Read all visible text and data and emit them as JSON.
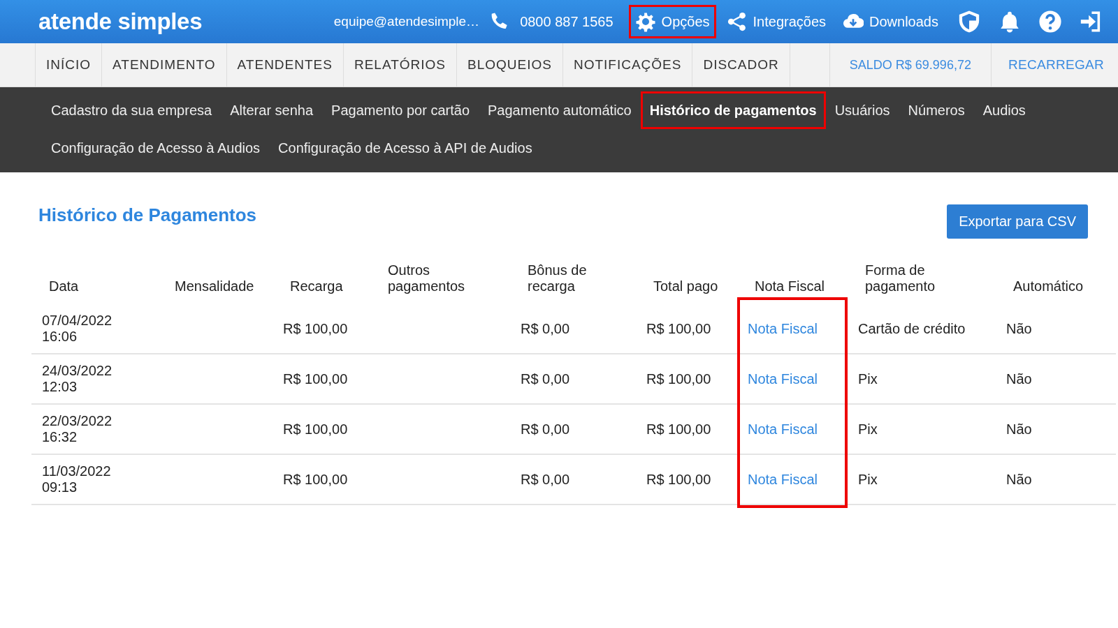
{
  "topbar": {
    "logo": "atende simples",
    "email": "equipe@atendesimple…",
    "phone": "0800 887 1565",
    "actions": [
      {
        "kind": "gear",
        "label": "Opções",
        "highlighted": true
      },
      {
        "kind": "share",
        "label": "Integrações",
        "highlighted": false
      },
      {
        "kind": "download",
        "label": "Downloads",
        "highlighted": false
      }
    ],
    "icons": [
      {
        "kind": "shield"
      },
      {
        "kind": "bell"
      },
      {
        "kind": "help"
      },
      {
        "kind": "signin"
      }
    ]
  },
  "nav": {
    "items": [
      "INÍCIO",
      "ATENDIMENTO",
      "ATENDENTES",
      "RELATÓRIOS",
      "BLOQUEIOS",
      "NOTIFICAÇÕES",
      "DISCADOR"
    ],
    "balance": "SALDO R$ 69.996,72",
    "recharge": "RECARREGAR"
  },
  "submenu": [
    {
      "label": "Cadastro da sua empresa",
      "selected": false,
      "highlighted": false
    },
    {
      "label": "Alterar senha",
      "selected": false,
      "highlighted": false
    },
    {
      "label": "Pagamento por cartão",
      "selected": false,
      "highlighted": false
    },
    {
      "label": "Pagamento automático",
      "selected": false,
      "highlighted": false
    },
    {
      "label": "Histórico de pagamentos",
      "selected": true,
      "highlighted": true
    },
    {
      "label": "Usuários",
      "selected": false,
      "highlighted": false
    },
    {
      "label": "Números",
      "selected": false,
      "highlighted": false
    },
    {
      "label": "Audios",
      "selected": false,
      "highlighted": false
    },
    {
      "label": "Configuração de Acesso à Audios",
      "selected": false,
      "highlighted": false
    },
    {
      "label": "Configuração de Acesso à API de Audios",
      "selected": false,
      "highlighted": false
    }
  ],
  "page_title": "Histórico de Pagamentos",
  "export_button": "Exportar para CSV",
  "table": {
    "columns": [
      {
        "label": "Data",
        "highlighted": false
      },
      {
        "label": "Mensalidade",
        "highlighted": false
      },
      {
        "label": "Recarga",
        "highlighted": false
      },
      {
        "label": "Outros pagamentos",
        "highlighted": false
      },
      {
        "label": "Bônus de recarga",
        "highlighted": false
      },
      {
        "label": "Total pago",
        "highlighted": false
      },
      {
        "label": "Nota Fiscal",
        "highlighted": true
      },
      {
        "label": "Forma de pagamento",
        "highlighted": false
      },
      {
        "label": "Automático",
        "highlighted": false
      }
    ],
    "rows": [
      [
        "07/04/2022 16:06",
        "",
        "R$ 100,00",
        "",
        "R$ 0,00",
        "R$ 100,00",
        "Nota Fiscal",
        "Cartão de crédito",
        "Não"
      ],
      [
        "24/03/2022 12:03",
        "",
        "R$ 100,00",
        "",
        "R$ 0,00",
        "R$ 100,00",
        "Nota Fiscal",
        "Pix",
        "Não"
      ],
      [
        "22/03/2022 16:32",
        "",
        "R$ 100,00",
        "",
        "R$ 0,00",
        "R$ 100,00",
        "Nota Fiscal",
        "Pix",
        "Não"
      ],
      [
        "11/03/2022 09:13",
        "",
        "R$ 100,00",
        "",
        "R$ 0,00",
        "R$ 100,00",
        "Nota Fiscal",
        "Pix",
        "Não"
      ]
    ]
  }
}
